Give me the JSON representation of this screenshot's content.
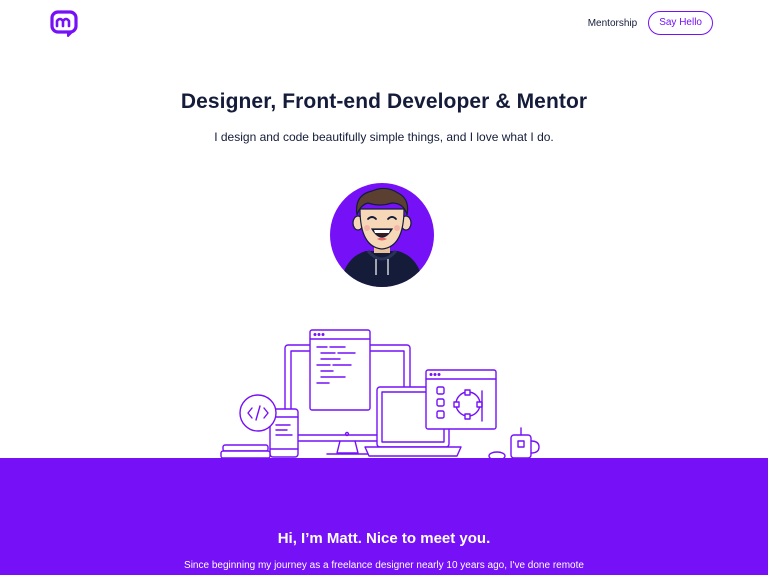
{
  "header": {
    "logo_icon": "m-monogram-logo-icon",
    "nav": {
      "mentorship_label": "Mentorship",
      "say_hello_label": "Say Hello"
    }
  },
  "hero": {
    "title": "Designer, Front-end Developer & Mentor",
    "subtitle": "I design and code beautifully simple things, and I love what I do.",
    "avatar_icon": "avatar-illustration",
    "illustration_icon": "devices-illustration"
  },
  "about": {
    "title": "Hi, I’m Matt. Nice to meet you.",
    "text": "Since beginning my journey as a freelance designer nearly 10 years ago, I've done remote"
  },
  "colors": {
    "accent": "#7510f7",
    "text": "#141c3a",
    "background": "#ffffff",
    "skin": "#f6d7b8",
    "hair": "#5b4032",
    "hoodie": "#141c3a"
  }
}
